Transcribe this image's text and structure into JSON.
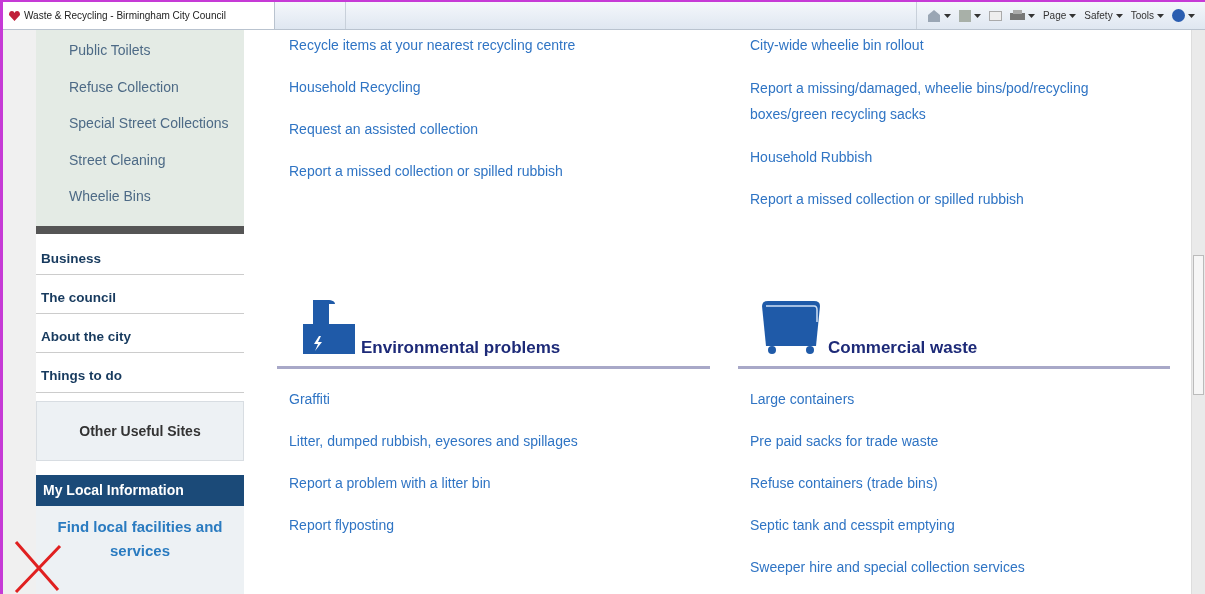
{
  "browser": {
    "tab_title": "Waste & Recycling - Birmingham City Council",
    "menus": [
      {
        "label": "Page"
      },
      {
        "label": "Safety"
      },
      {
        "label": "Tools"
      }
    ]
  },
  "sidebar": {
    "sub_items": [
      "Public Toilets",
      "Refuse Collection",
      "Special Street Collections",
      "Street Cleaning",
      "Wheelie Bins"
    ],
    "nav_items": [
      "Business",
      "The council",
      "About the city",
      "Things to do"
    ],
    "useful_sites": "Other Useful Sites",
    "local_info": {
      "title": "My Local Information",
      "link": "Find local facilities and services"
    }
  },
  "columns": [
    {
      "links": [
        "Recycle items at your nearest recycling centre",
        "Household Recycling",
        "Request an assisted collection",
        "Report a missed collection or spilled rubbish"
      ],
      "section": {
        "kind": "factory",
        "title": "Environmental problems",
        "links": [
          "Graffiti",
          "Litter, dumped rubbish, eyesores and spillages",
          "Report a problem with a litter bin",
          "Report flyposting"
        ]
      }
    },
    {
      "links": [
        "City-wide wheelie bin rollout",
        "Report a missing/damaged, wheelie bins/pod/recycling boxes/green recycling sacks",
        "Household Rubbish",
        "Report a missed collection or spilled rubbish"
      ],
      "section": {
        "kind": "bin",
        "title": "Commercial waste",
        "links": [
          "Large containers",
          "Pre paid sacks for trade waste",
          "Refuse containers (trade bins)",
          "Septic tank and cesspit emptying",
          "Sweeper hire and special collection services"
        ]
      }
    }
  ]
}
